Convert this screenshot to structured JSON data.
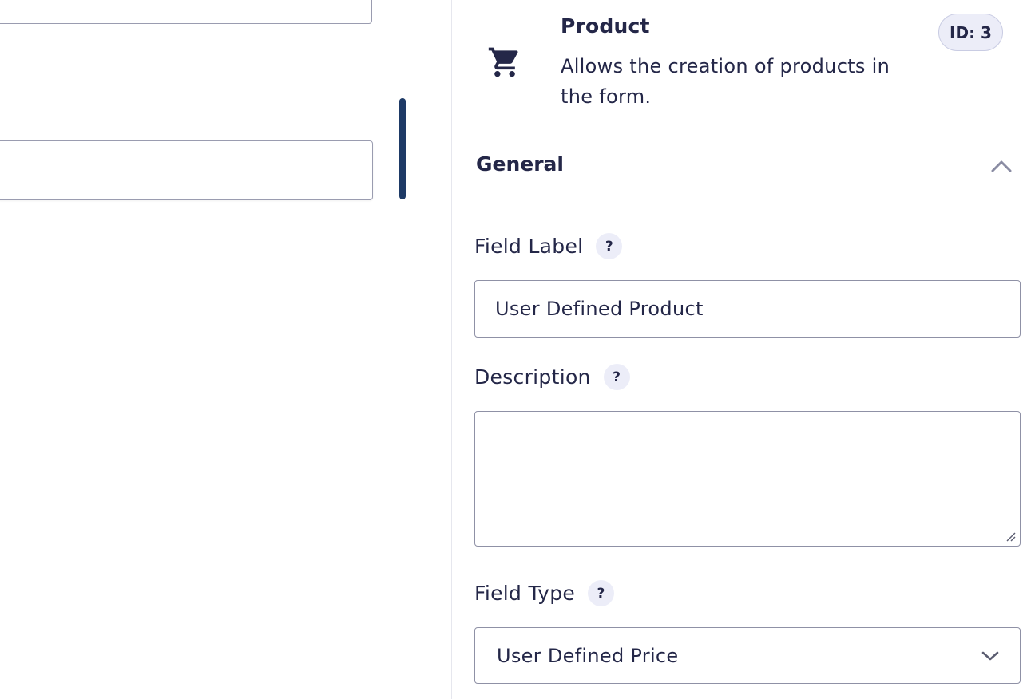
{
  "field": {
    "name": "Product",
    "description": "Allows the creation of products in the form.",
    "id_badge": "ID: 3",
    "icon": "shopping-cart-icon"
  },
  "section": {
    "title": "General",
    "toggle_icon": "chevron-up-icon"
  },
  "settings": {
    "field_label": {
      "label": "Field Label",
      "help": "?",
      "value": "User Defined Product"
    },
    "description": {
      "label": "Description",
      "help": "?",
      "value": ""
    },
    "field_type": {
      "label": "Field Type",
      "help": "?",
      "selected": "User Defined Price"
    }
  },
  "colors": {
    "text": "#242748",
    "selection_bar": "#1e3a66",
    "badge_bg": "#ecedf8",
    "border": "#8f91a6"
  }
}
